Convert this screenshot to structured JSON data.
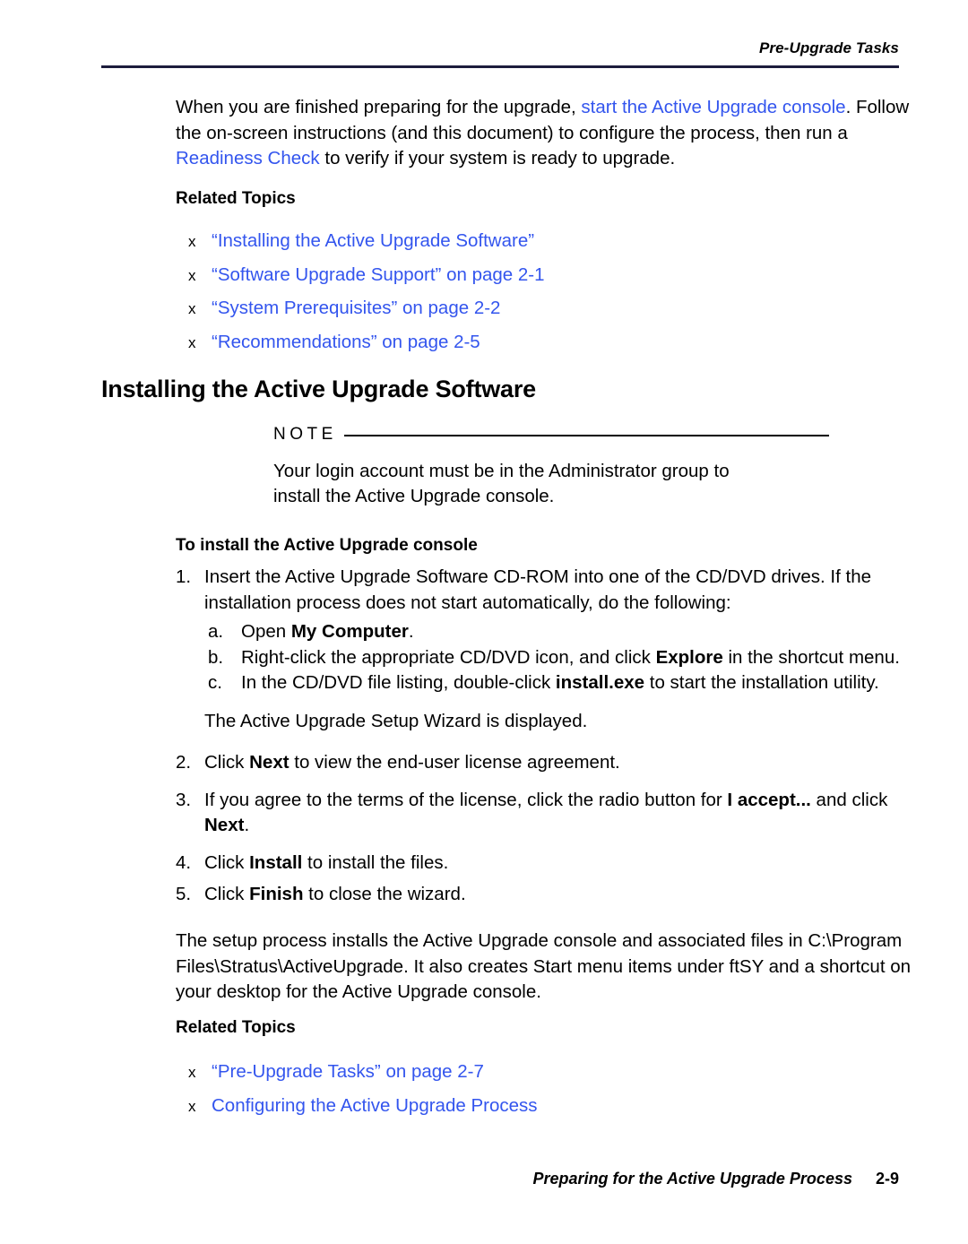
{
  "header": {
    "running_head": "Pre-Upgrade Tasks"
  },
  "intro": {
    "seg1": "When you are finished preparing for the upgrade, ",
    "link1": "start the Active Upgrade console",
    "seg2": ". Follow the on-screen instructions (and this document) to configure the process, then run a ",
    "link2": "Readiness Check",
    "seg3": " to verify if your system is ready to upgrade."
  },
  "related_topics_top": {
    "title": "Related Topics",
    "bullet_glyph": "x",
    "items": [
      "“Installing the Active Upgrade Software”",
      "“Software Upgrade Support” on page 2-1",
      "“System Prerequisites” on page 2-2",
      "“Recommendations” on page 2-5"
    ]
  },
  "section": {
    "heading": "Installing the Active Upgrade Software"
  },
  "note": {
    "label": "NOTE",
    "body": "Your login account must be in the Administrator group to install the Active Upgrade console."
  },
  "procedure": {
    "heading": "To install the Active Upgrade console",
    "step1": {
      "num": "1.",
      "text": "Insert the Active Upgrade Software CD-ROM into one of the CD/DVD drives. If the installation process does not start automatically, do the following:"
    },
    "sub_a": {
      "num": "a.",
      "seg1": "Open ",
      "bold1": "My Computer",
      "seg2": "."
    },
    "sub_b": {
      "num": "b.",
      "seg1": "Right-click the appropriate CD/DVD icon, and click ",
      "bold1": "Explore",
      "seg2": " in the shortcut menu."
    },
    "sub_c": {
      "num": "c.",
      "seg1": "In the CD/DVD file listing, double-click ",
      "bold1": "install.exe",
      "seg2": " to start the installation utility."
    },
    "wizard_line": "The Active Upgrade Setup Wizard is displayed.",
    "step2": {
      "num": "2.",
      "seg1": "Click ",
      "bold1": "Next",
      "seg2": " to view the end-user license agreement."
    },
    "step3": {
      "num": "3.",
      "seg1": "If you agree to the terms of the license, click the radio button for ",
      "bold1": "I accept...",
      "seg2": " and click ",
      "bold2": "Next",
      "seg3": "."
    },
    "step4": {
      "num": "4.",
      "seg1": "Click ",
      "bold1": "Install",
      "seg2": " to install the files."
    },
    "step5": {
      "num": "5.",
      "seg1": "Click ",
      "bold1": "Finish",
      "seg2": " to close the wizard."
    }
  },
  "closing": {
    "text": "The setup process installs the Active Upgrade console and associated files in C:\\Program Files\\Stratus\\ActiveUpgrade. It also creates Start menu items under ftSY and a shortcut on your desktop for the Active Upgrade console."
  },
  "related_topics_bottom": {
    "title": "Related Topics",
    "bullet_glyph": "x",
    "items": [
      "“Pre-Upgrade Tasks” on page 2-7",
      "Configuring the Active Upgrade Process"
    ]
  },
  "footer": {
    "text": "Preparing for the Active Upgrade Process",
    "page_number": "2-9"
  },
  "colors": {
    "link": "#3355ee",
    "rule": "#1c1c3c",
    "text": "#000000"
  }
}
